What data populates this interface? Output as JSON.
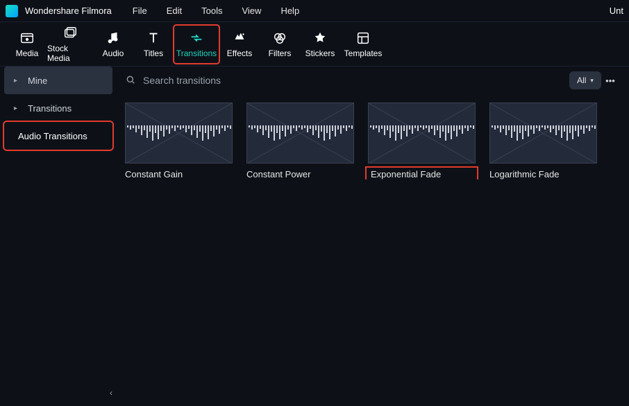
{
  "app": {
    "title": "Wondershare Filmora",
    "right_trunc": "Unt"
  },
  "menu": {
    "file": "File",
    "edit": "Edit",
    "tools": "Tools",
    "view": "View",
    "help": "Help"
  },
  "toolbar": {
    "media": "Media",
    "stock_media": "Stock Media",
    "audio": "Audio",
    "titles": "Titles",
    "transitions": "Transitions",
    "effects": "Effects",
    "filters": "Filters",
    "stickers": "Stickers",
    "templates": "Templates"
  },
  "sidebar": {
    "mine": "Mine",
    "transitions": "Transitions",
    "audio_transitions": "Audio Transitions"
  },
  "search": {
    "placeholder": "Search transitions"
  },
  "filter": {
    "label": "All"
  },
  "cards": {
    "constant_gain": "Constant Gain",
    "constant_power": "Constant Power",
    "exponential_fade": "Exponential Fade",
    "logarithmic_fade": "Logarithmic Fade"
  }
}
